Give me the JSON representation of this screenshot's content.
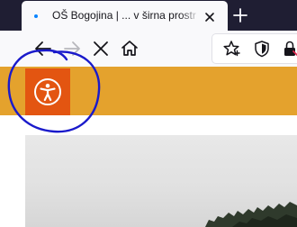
{
  "browser": {
    "tab": {
      "title": "OŠ Bogojina | ... v širna prostrar",
      "status_color": "#0a84ff",
      "close_icon": "close-icon"
    },
    "new_tab_icon": "plus-icon",
    "toolbar": {
      "icons": [
        "back-arrow-icon",
        "forward-arrow-icon",
        "stop-icon",
        "home-icon",
        "bookmark-star-icon",
        "shield-icon",
        "lock-icon"
      ]
    },
    "colors": {
      "tabstrip": "#1f1e33",
      "toolbar": "#f9f9fb"
    }
  },
  "page": {
    "header_color": "#e4a22d",
    "accessibility_button": {
      "icon": "accessibility-icon",
      "background": "#e35511"
    },
    "annotation": {
      "shape": "hand-drawn circle",
      "color": "#1a1acb"
    }
  }
}
